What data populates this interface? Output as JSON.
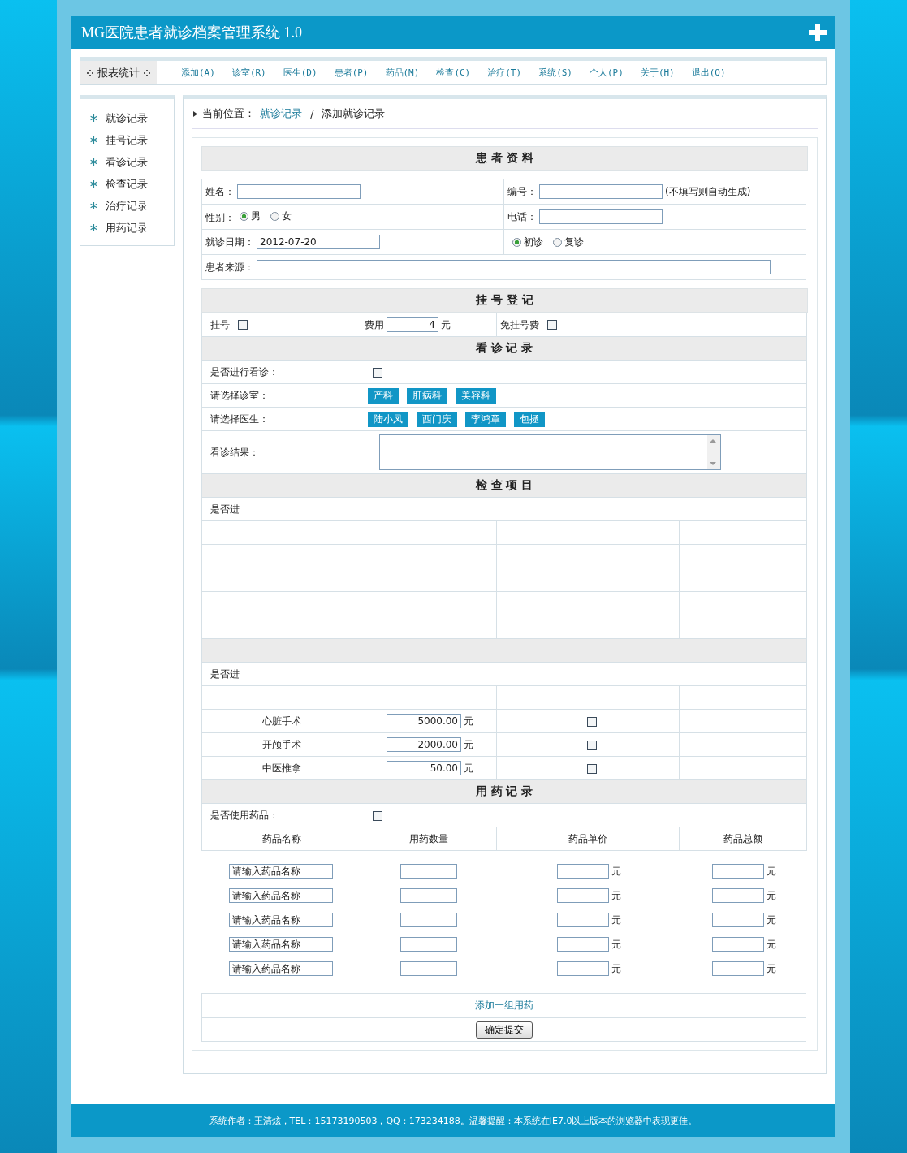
{
  "window": {
    "title": "MG医院患者就诊档案管理系统 1.0"
  },
  "nav": {
    "report": "报表统计",
    "items": [
      "添加(A)",
      "诊室(R)",
      "医生(D)",
      "患者(P)",
      "药品(M)",
      "检查(C)",
      "治疗(T)",
      "系统(S)",
      "个人(P)",
      "关于(H)",
      "退出(Q)"
    ]
  },
  "sidebar": {
    "items": [
      "就诊记录",
      "挂号记录",
      "看诊记录",
      "检查记录",
      "治疗记录",
      "用药记录"
    ]
  },
  "breadcrumb": {
    "label": "当前位置：",
    "link": "就诊记录",
    "separator": "/",
    "current": "添加就诊记录"
  },
  "patient": {
    "heading": "患 者 资 料",
    "name_label": "姓名：",
    "number_label": "编号：",
    "number_hint": "(不填写则自动生成)",
    "gender_label": "性别：",
    "genders": [
      {
        "label": "男",
        "selected": true
      },
      {
        "label": "女",
        "selected": false
      }
    ],
    "phone_label": "电话：",
    "date_label": "就诊日期：",
    "date_value": "2012-07-20",
    "visit_types": [
      {
        "label": "初诊",
        "selected": true
      },
      {
        "label": "复诊",
        "selected": false
      }
    ],
    "source_label": "患者来源："
  },
  "registration": {
    "heading": "挂 号 登 记",
    "register_label": "挂号",
    "register_checked": false,
    "fee_label": "费用",
    "fee_value": "4",
    "fee_unit": "元",
    "free_label": "免挂号费",
    "free_checked": false
  },
  "consultation": {
    "heading": "看 诊 记 录",
    "do_label": "是否进行看诊：",
    "do_checked": false,
    "room_label": "请选择诊室：",
    "rooms": [
      "产科",
      "肝病科",
      "美容科"
    ],
    "doctor_label": "请选择医生：",
    "doctors": [
      "陆小凤",
      "西门庆",
      "李鸿章",
      "包拯"
    ],
    "result_label": "看诊结果："
  },
  "examination": {
    "heading": "检 查 项 目",
    "rows": [
      "是否进"
    ]
  },
  "treatment": {
    "rows": [
      "是否进"
    ],
    "items": [
      {
        "name": "心脏手术",
        "price": "5000.00",
        "unit": "元",
        "checked": false
      },
      {
        "name": "开颅手术",
        "price": "2000.00",
        "unit": "元",
        "checked": false
      },
      {
        "name": "中医推拿",
        "price": "50.00",
        "unit": "元",
        "checked": false
      }
    ]
  },
  "medication": {
    "heading": "用 药 记 录",
    "use_label": "是否使用药品：",
    "use_checked": false,
    "columns": [
      "药品名称",
      "用药数量",
      "药品单价",
      "药品总额"
    ],
    "rows": [
      {
        "name_value": "请输入药品名称",
        "unit": "元",
        "total_unit": "元"
      },
      {
        "name_value": "请输入药品名称",
        "unit": "元",
        "total_unit": "元"
      },
      {
        "name_value": "请输入药品名称",
        "unit": "元",
        "total_unit": "元"
      },
      {
        "name_value": "请输入药品名称",
        "unit": "元",
        "total_unit": "元"
      },
      {
        "name_value": "请输入药品名称",
        "unit": "元",
        "total_unit": "元"
      }
    ],
    "add_link": "添加一组用药",
    "submit": "确定提交"
  },
  "footer": {
    "text": "系统作者：王清炫，TEL：15173190503，QQ：173234188。温馨提醒：本系统在IE7.0以上版本的浏览器中表现更佳。"
  }
}
